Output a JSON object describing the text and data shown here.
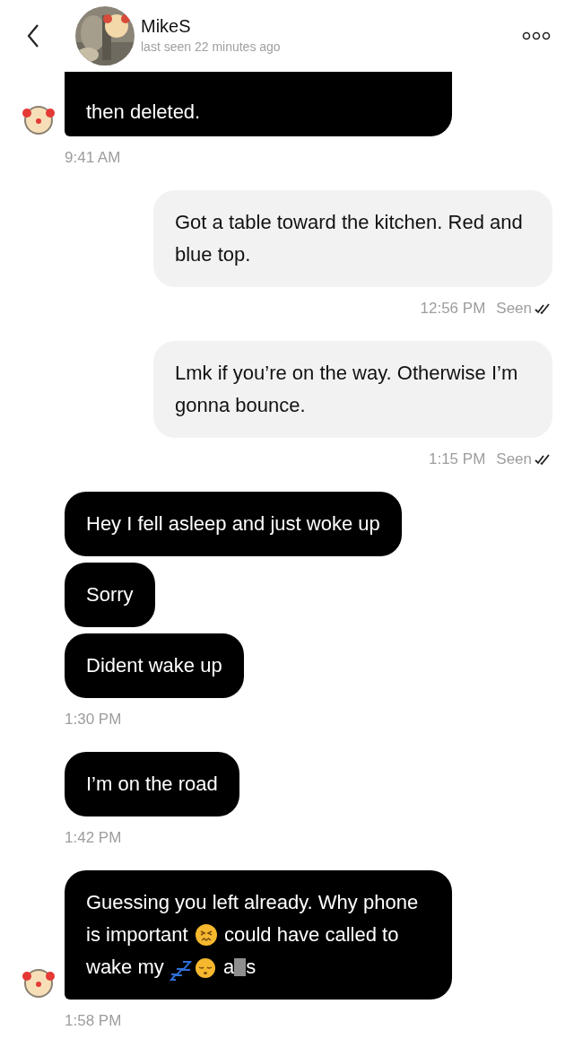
{
  "header": {
    "name": "MikeS",
    "status": "last seen 22 minutes ago"
  },
  "groups": [
    {
      "kind": "incoming",
      "avatar": true,
      "bubbles": [
        {
          "text": "then deleted."
        }
      ],
      "time": "9:41 AM"
    },
    {
      "kind": "outgoing",
      "avatar": false,
      "bubbles": [
        {
          "text": "Got a table toward the kitchen. Red and blue top."
        }
      ],
      "time": "12:56 PM",
      "status": "Seen"
    },
    {
      "kind": "outgoing",
      "avatar": false,
      "bubbles": [
        {
          "text": "Lmk if you’re on the way. Otherwise I’m gonna bounce."
        }
      ],
      "time": "1:15 PM",
      "status": "Seen"
    },
    {
      "kind": "incoming",
      "avatar": false,
      "bubbles": [
        {
          "text": "Hey I fell asleep and just woke up"
        },
        {
          "text": "Sorry"
        },
        {
          "text": "Dident wake up"
        }
      ],
      "time": "1:30 PM"
    },
    {
      "kind": "incoming",
      "avatar": false,
      "bubbles": [
        {
          "text": "I’m on the road"
        }
      ],
      "time": "1:42 PM"
    },
    {
      "kind": "incoming",
      "avatar": true,
      "bubbles": [
        {
          "parts": [
            {
              "kind": "text",
              "text": "Guessing you left already. Why phone is important "
            },
            {
              "kind": "angry-emoji"
            },
            {
              "kind": "text",
              "text": " could have called to wake my "
            },
            {
              "kind": "zzz-emoji"
            },
            {
              "kind": "sleep-emoji"
            },
            {
              "kind": "text",
              "text": " a"
            },
            {
              "kind": "redaction"
            },
            {
              "kind": "text",
              "text": "s"
            }
          ]
        }
      ],
      "time": "1:58 PM"
    }
  ]
}
